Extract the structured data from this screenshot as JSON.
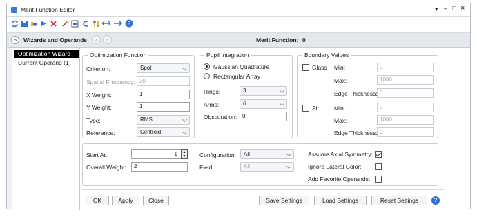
{
  "window": {
    "title": "Merit Function Editor",
    "controls": {
      "dropdown": "▾",
      "minimize": "–",
      "maximize": "□",
      "close": "×"
    }
  },
  "toolbar": {
    "icons": [
      "refresh-icon",
      "save-icon",
      "folder-icon",
      "arrow-down-icon",
      "delete-icon",
      "wizard-icon",
      "window-icon",
      "curve-icon",
      "sort-icon",
      "link-icon",
      "forward-icon",
      "help-icon"
    ]
  },
  "wizbar": {
    "toggle": "^",
    "label": "Wizards and Operands",
    "prev": "‹",
    "next": "›",
    "merit_label": "Merit Function:",
    "merit_value": "0"
  },
  "sidebar": {
    "items": [
      {
        "label": "Optimization Wizard",
        "active": true
      },
      {
        "label": "Current Operand (1)",
        "active": false
      }
    ]
  },
  "optfunc": {
    "title": "Optimization Function",
    "criterion": {
      "label": "Criterion:",
      "value": "Spot"
    },
    "spatial": {
      "label": "Spatial Frequency:",
      "value": "30"
    },
    "xweight": {
      "label": "X Weight:",
      "value": "1"
    },
    "yweight": {
      "label": "Y Weight:",
      "value": "1"
    },
    "type": {
      "label": "Type:",
      "value": "RMS"
    },
    "reference": {
      "label": "Reference:",
      "value": "Centroid"
    }
  },
  "pupil": {
    "title": "Pupil Integration",
    "gaussian": "Gaussian Quadrature",
    "rect": "Rectangular Array",
    "rings": {
      "label": "Rings:",
      "value": "3"
    },
    "arms": {
      "label": "Arms:",
      "value": "6"
    },
    "obscuration": {
      "label": "Obscuration:",
      "value": "0"
    }
  },
  "boundary": {
    "title": "Boundary Values",
    "glass": {
      "label": "Glass",
      "min_label": "Min:",
      "min": "0",
      "max_label": "Max:",
      "max": "1000",
      "edge_label": "Edge Thickness:",
      "edge": "0"
    },
    "air": {
      "label": "Air",
      "min_label": "Min:",
      "min": "0",
      "max_label": "Max:",
      "max": "1000",
      "edge_label": "Edge Thickness:",
      "edge": "0"
    }
  },
  "bottom": {
    "startat": {
      "label": "Start At:",
      "value": "1"
    },
    "overall": {
      "label": "Overall Weight:",
      "value": "2"
    },
    "config": {
      "label": "Configuration:",
      "value": "All"
    },
    "field": {
      "label": "Field:",
      "value": "All"
    },
    "axial": {
      "label": "Assume Axial Symmetry:",
      "checked": true
    },
    "lateral": {
      "label": "Ignore Lateral Color:",
      "checked": false
    },
    "favorite": {
      "label": "Add Favorite Operands:",
      "checked": false
    }
  },
  "buttons": {
    "ok": "OK",
    "apply": "Apply",
    "close": "Close",
    "save": "Save Settings",
    "load": "Load Settings",
    "reset": "Reset Settings",
    "help": "?"
  },
  "colors": {
    "accent": "#2f6fd6",
    "sidebar_active_bg": "#000000",
    "window_bg": "#eef0f3"
  }
}
